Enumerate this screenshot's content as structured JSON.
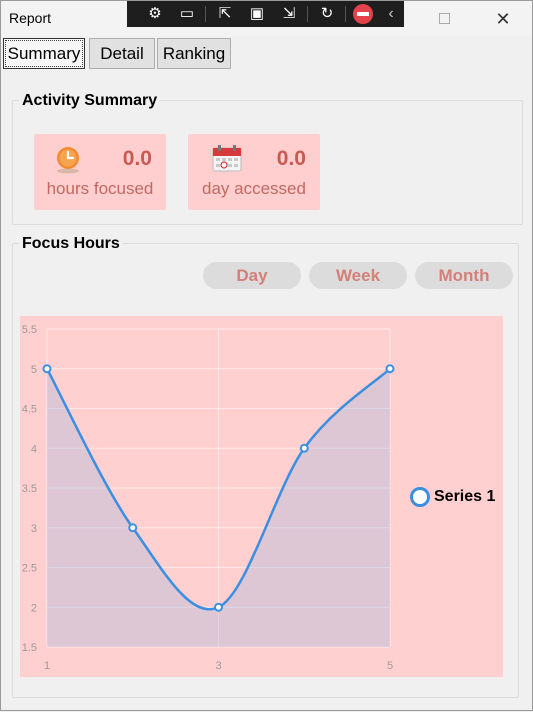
{
  "window": {
    "title": "Report"
  },
  "tabs": [
    {
      "label": "Summary"
    },
    {
      "label": "Detail"
    },
    {
      "label": "Ranking"
    }
  ],
  "activity_summary": {
    "title": "Activity Summary",
    "cards": [
      {
        "value": "0.0",
        "label": "hours focused",
        "icon": "clock-icon"
      },
      {
        "value": "0.0",
        "label": "day accessed",
        "icon": "calendar-icon"
      }
    ]
  },
  "focus_hours": {
    "title": "Focus Hours",
    "buttons": [
      {
        "label": "Day"
      },
      {
        "label": "Week"
      },
      {
        "label": "Month"
      }
    ]
  },
  "colors": {
    "accent": "#3a8fe0",
    "card_bg": "#ffcfcf",
    "card_text": "#c85a52",
    "chart_bg": "#ffd0cf"
  },
  "chart_data": {
    "type": "line",
    "x": [
      1,
      2,
      3,
      4,
      5
    ],
    "series": [
      {
        "name": "Series 1",
        "values": [
          5,
          3,
          2,
          4,
          5
        ]
      }
    ],
    "xticks": [
      1,
      3,
      5
    ],
    "yticks": [
      "1.5",
      "2",
      "2.5",
      "3",
      "3.5",
      "4",
      "4.5",
      "5",
      "5.5"
    ],
    "xlim": [
      1,
      5
    ],
    "ylim": [
      1.5,
      5.5
    ],
    "grid": true,
    "fill": "area",
    "legend": "right"
  }
}
